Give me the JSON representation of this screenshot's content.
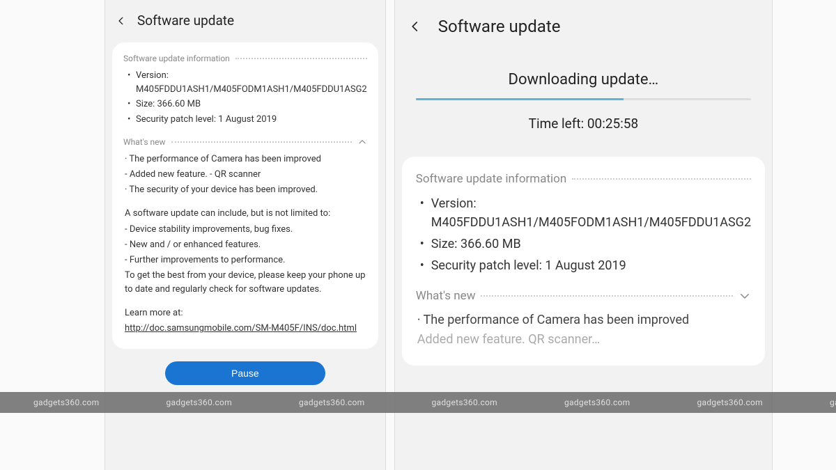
{
  "watermark": "gadgets360.com",
  "left": {
    "header_title": "Software update",
    "info_header": "Software update information",
    "version_label": "Version: M405FDDU1ASH1/M405FODM1ASH1/M405FDDU1ASG2",
    "size_label": "Size: 366.60 MB",
    "security_label": "Security patch level: 1 August 2019",
    "whatsnew_header": "What's new",
    "wn_line1": "· The performance of Camera has been improved",
    "wn_line2": " - Added new feature. - QR scanner",
    "wn_line3": "· The security of your device has been improved.",
    "wn_para1": "A software update can include, but is not limited to:",
    "wn_b1": " - Device stability improvements, bug fixes.",
    "wn_b2": " - New and / or enhanced features.",
    "wn_b3": " - Further improvements to performance.",
    "wn_para2": "To get the best from your device, please keep your phone up to date and regularly check for software updates.",
    "learn_more": "Learn more at:",
    "link": "http://doc.samsungmobile.com/SM-M405F/INS/doc.html",
    "pause_label": "Pause"
  },
  "right": {
    "header_title": "Software update",
    "downloading": "Downloading update…",
    "time_left": "Time left: 00:25:58",
    "info_header": "Software update information",
    "version_label": "Version: M405FDDU1ASH1/M405FODM1ASH1/M405FDDU1ASG2",
    "size_label": "Size: 366.60 MB",
    "security_label": "Security patch level: 1 August 2019",
    "whatsnew_header": "What's new",
    "wn_line1": "· The performance of Camera has been improved",
    "wn_line2": "   Added new feature.   QR scanner…"
  }
}
